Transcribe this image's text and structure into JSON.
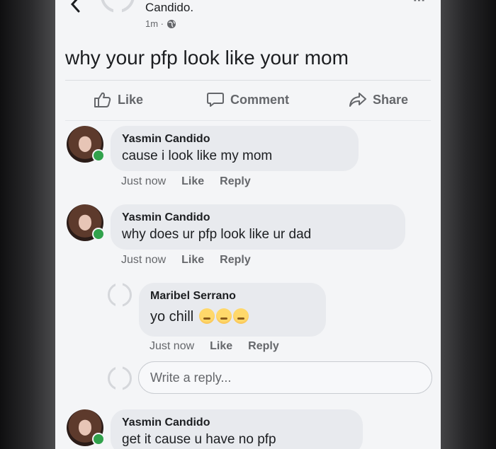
{
  "post": {
    "author": "Candido.",
    "time": "1m ·",
    "text": "why your pfp look like your mom",
    "more": "···"
  },
  "actions": {
    "like": "Like",
    "comment": "Comment",
    "share": "Share"
  },
  "comments": [
    {
      "name": "Yasmin Candido",
      "text": "cause i look like my mom",
      "time": "Just now",
      "like": "Like",
      "reply": "Reply"
    },
    {
      "name": "Yasmin Candido",
      "text": "why does ur pfp look like ur dad",
      "time": "Just now",
      "like": "Like",
      "reply": "Reply"
    },
    {
      "name": "Maribel Serrano",
      "text": "yo chill",
      "time": "Just now",
      "like": "Like",
      "reply": "Reply",
      "emojis": [
        "crying-face-icon",
        "crying-face-icon",
        "crying-face-icon"
      ]
    },
    {
      "name": "Yasmin Candido",
      "text": "get it cause u have no pfp"
    }
  ],
  "reply_box": {
    "placeholder": "Write a reply..."
  },
  "colors": {
    "online": "#31a24c",
    "bubble": "#e8eaee",
    "muted": "#65676b"
  }
}
